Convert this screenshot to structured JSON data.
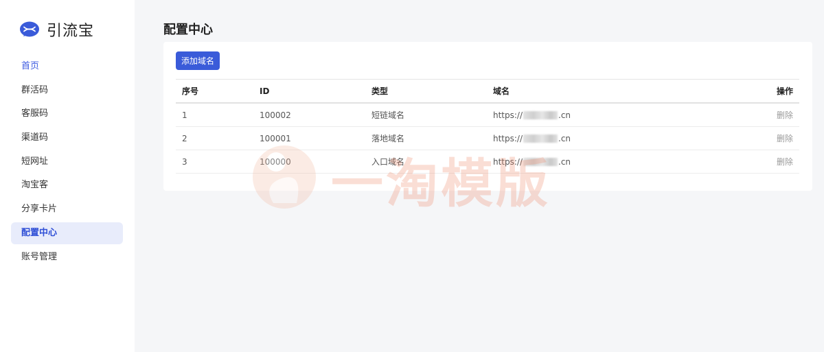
{
  "app": {
    "name": "引流宝"
  },
  "sidebar": {
    "items": [
      {
        "label": "首页"
      },
      {
        "label": "群活码"
      },
      {
        "label": "客服码"
      },
      {
        "label": "渠道码"
      },
      {
        "label": "短网址"
      },
      {
        "label": "淘宝客"
      },
      {
        "label": "分享卡片"
      },
      {
        "label": "配置中心"
      },
      {
        "label": "账号管理"
      }
    ]
  },
  "main": {
    "title": "配置中心",
    "add_button": "添加域名",
    "columns": [
      "序号",
      "ID",
      "类型",
      "域名",
      "操作"
    ],
    "rows": [
      {
        "index": "1",
        "id": "100002",
        "type": "短链域名",
        "domain_prefix": "https://",
        "domain_suffix": ".cn",
        "action": "删除"
      },
      {
        "index": "2",
        "id": "100001",
        "type": "落地域名",
        "domain_prefix": "https://",
        "domain_suffix": ".cn",
        "action": "删除"
      },
      {
        "index": "3",
        "id": "100000",
        "type": "入口域名",
        "domain_prefix": "https://",
        "domain_suffix": ".cn",
        "action": "删除"
      }
    ]
  },
  "watermark": {
    "text": "一淘模版"
  },
  "colors": {
    "primary": "#3a5bd9",
    "active_bg": "#e8ecfb",
    "watermark": "#f08a6a"
  }
}
